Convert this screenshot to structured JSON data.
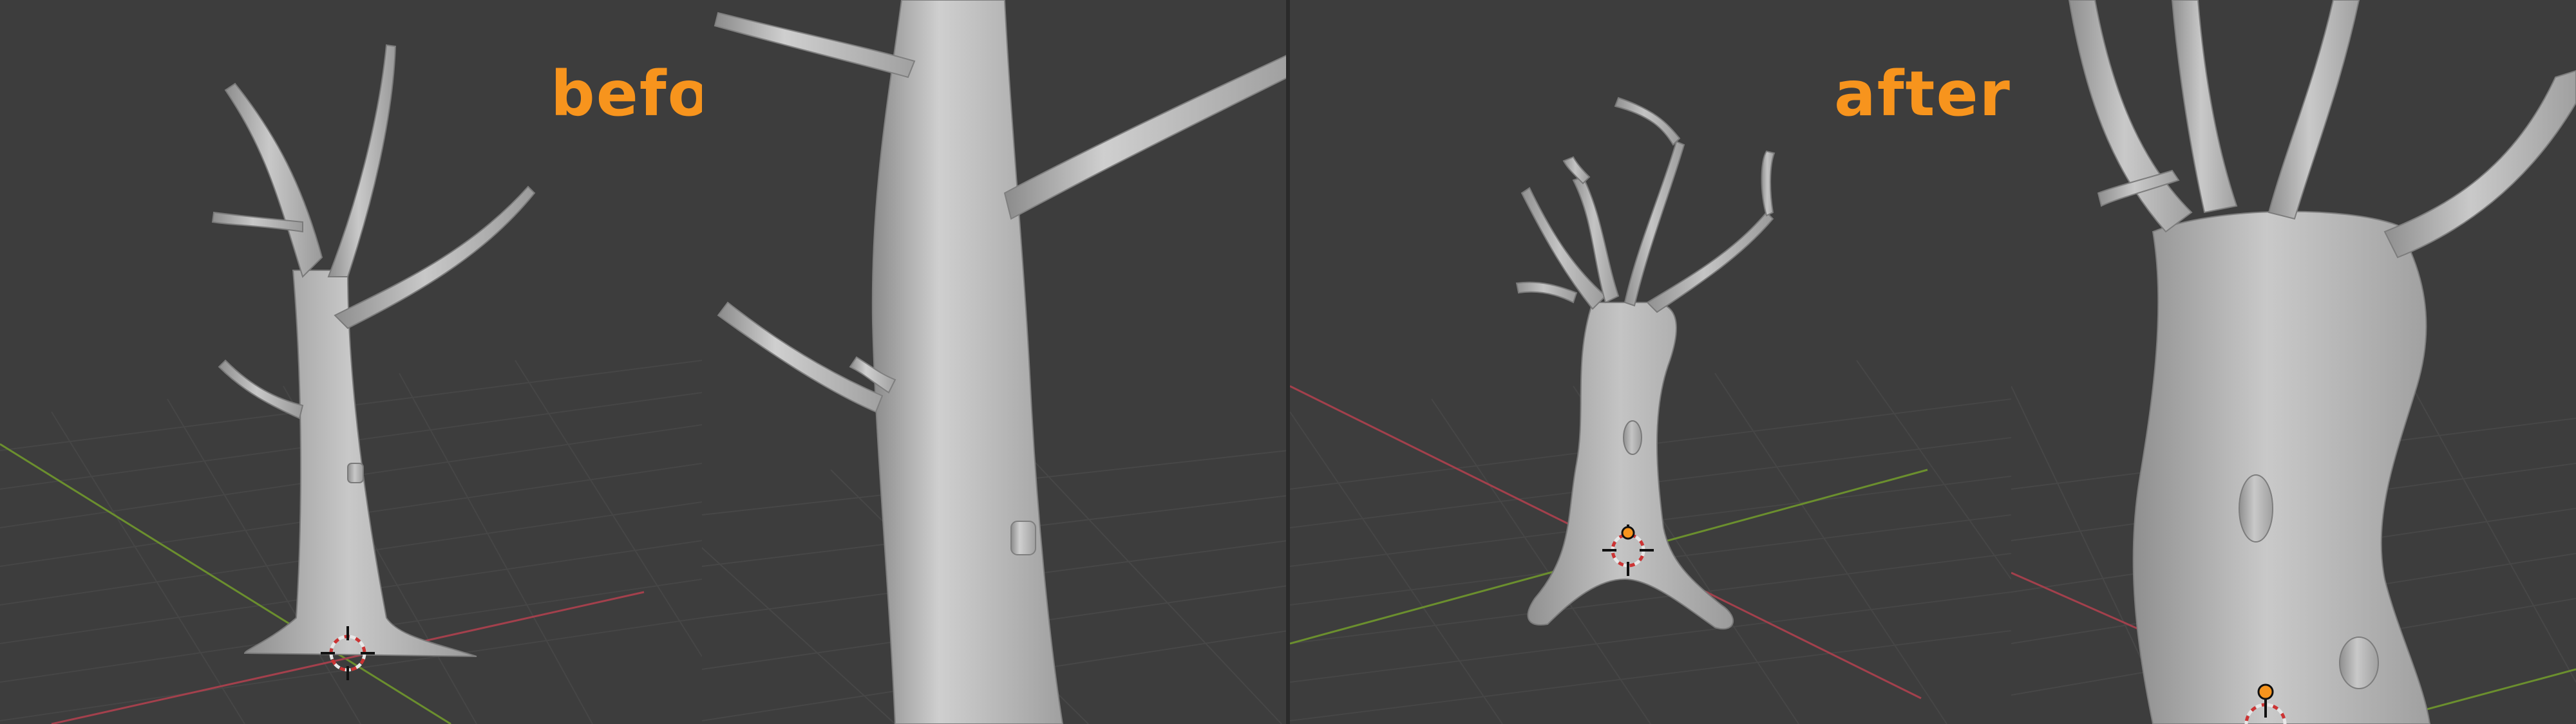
{
  "labels": {
    "before": "before",
    "after": "after"
  },
  "colors": {
    "label": "#f7941d",
    "viewport_bg": "#3d3d3d",
    "grid": "#474747",
    "x_axis": "#a3404c",
    "y_axis": "#6b8f2e",
    "mesh": "#b5b5b5"
  },
  "icons": {
    "origin": "3d-cursor-icon",
    "light": "object-origin-icon"
  }
}
